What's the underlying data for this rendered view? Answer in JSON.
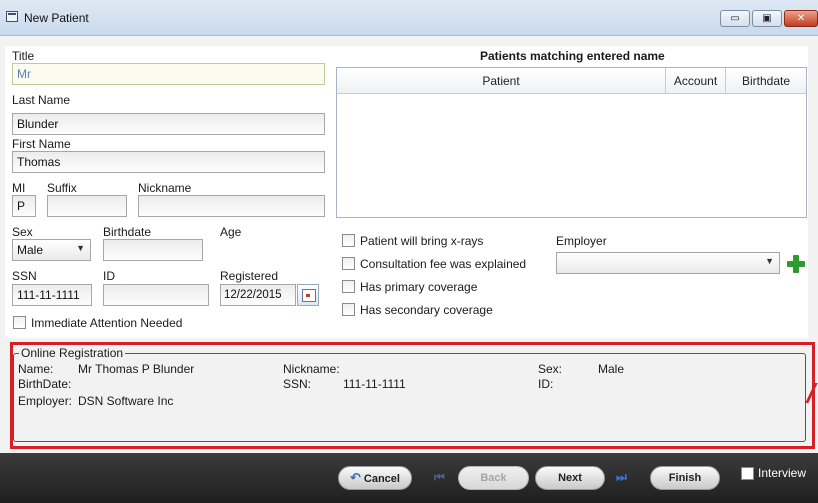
{
  "window": {
    "title": "New Patient",
    "minimize": "▭",
    "maximize": "▣",
    "close": "✕"
  },
  "form": {
    "title_label": "Title",
    "title_value": "Mr",
    "last_name_label": "Last Name",
    "last_name_value": "Blunder",
    "first_name_label": "First Name",
    "first_name_value": "Thomas",
    "mi_label": "MI",
    "mi_value": "P",
    "suffix_label": "Suffix",
    "suffix_value": "",
    "nickname_label": "Nickname",
    "nickname_value": "",
    "sex_label": "Sex",
    "sex_value": "Male",
    "birthdate_label": "Birthdate",
    "birthdate_value": "",
    "age_label": "Age",
    "ssn_label": "SSN",
    "ssn_value": "111-11-1111",
    "id_label": "ID",
    "id_value": "",
    "registered_label": "Registered",
    "registered_value": "12/22/2015",
    "immediate_label": "Immediate Attention Needed"
  },
  "matches": {
    "title": "Patients matching entered name",
    "columns": [
      "Patient",
      "Account",
      "Birthdate"
    ]
  },
  "options": {
    "xrays": "Patient will bring x-rays",
    "consultation": "Consultation fee was explained",
    "primary": "Has primary coverage",
    "secondary": "Has secondary coverage",
    "employer_label": "Employer",
    "employer_value": ""
  },
  "online": {
    "legend": "Online Registration",
    "name_label": "Name:",
    "name_value": "Mr Thomas P Blunder",
    "nickname_label": "Nickname:",
    "nickname_value": "",
    "sex_label": "Sex:",
    "sex_value": "Male",
    "birthdate_label": "BirthDate:",
    "birthdate_value": "",
    "ssn_label": "SSN:",
    "ssn_value": "111-11-1111",
    "id_label": "ID:",
    "id_value": "",
    "employer_label": "Employer:",
    "employer_value": "DSN Software Inc"
  },
  "footer": {
    "cancel": "Cancel",
    "back": "Back",
    "next": "Next",
    "finish": "Finish",
    "interview": "Interview",
    "first_icon": "⏮",
    "last_icon": "⏭",
    "undo_icon": "↶"
  },
  "colors": {
    "highlight": "#d42026",
    "add_green": "#2e9b2e",
    "bar": "#2a2a2a"
  }
}
